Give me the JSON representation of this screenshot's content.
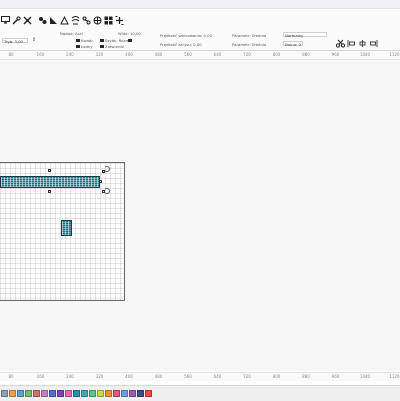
{
  "toolbar": {
    "icons": [
      "monitor-icon",
      "tools-icon",
      "settings-icon",
      "layers-icon",
      "align-icon",
      "shapes-icon",
      "text-icon",
      "crop-icon",
      "move-icon",
      "grid-icon",
      "add-icon"
    ],
    "mode_label": "Tryb: 3,00",
    "type_label": "Nazwa: Arai",
    "opt1": "Kwadr.",
    "opt2": "Ładny",
    "opt3": "Szybk. Rozm.",
    "opt4": "Zatwierdź",
    "wide_label": "Wide: 10,00",
    "speed1": "Prędkość szkicowania: 0,00",
    "speed2": "Prędkość zarysu: 0,00",
    "group1_label": "Parametr: Średnia",
    "group1_value": "Normalny",
    "group2_label": "Parametr: Średnia",
    "group2_value": "Dolna: 0",
    "right_icons": [
      "scissors-icon",
      "align-left-icon",
      "align-center-icon",
      "align-right-icon"
    ]
  },
  "ruler": {
    "ticks": [
      "80",
      "160",
      "240",
      "320",
      "400",
      "480",
      "560",
      "640",
      "720",
      "800",
      "880",
      "960",
      "1040",
      "1120"
    ]
  },
  "palette": {
    "swatch_colors": [
      "#8ea1b8",
      "#e8a24f",
      "#5aa3d9",
      "#6fbf73",
      "#d26d6d",
      "#c07fc7",
      "#4f6dd6",
      "#7a48b5",
      "#e56ab3",
      "#2f8ab0",
      "#3fa7b9",
      "#62c08d",
      "#c9d94d",
      "#f08f3a",
      "#d95a7b",
      "#6b9ee0",
      "#9b59b6",
      "#3a4d8f",
      "#e74c3c"
    ]
  }
}
